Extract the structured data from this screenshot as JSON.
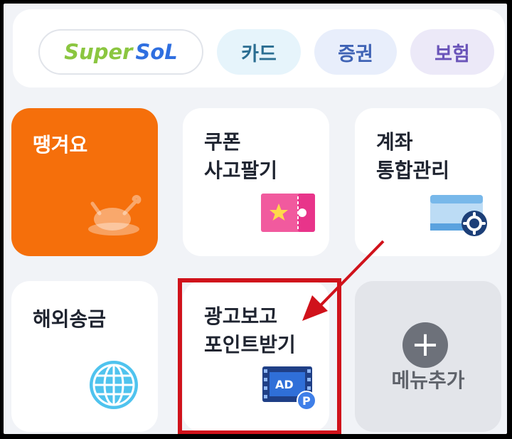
{
  "top_bar": {
    "supersol": {
      "part1": "Super",
      "part2": "SoL"
    },
    "card_label": "카드",
    "securities_label": "증권",
    "insurance_label": "보험"
  },
  "tiles": {
    "ttanggyeoyo": {
      "label": "땡겨요",
      "icon": "roast-chicken-icon"
    },
    "coupon": {
      "label": "쿠폰\n사고팔기",
      "icon": "ticket-star-icon"
    },
    "account": {
      "label": "계좌\n통합관리",
      "icon": "card-settings-icon"
    },
    "remittance": {
      "label": "해외송금",
      "icon": "globe-icon"
    },
    "ad_points": {
      "label": "광고보고\n포인트받기",
      "icon": "ad-film-icon",
      "badge_ad": "AD",
      "badge_p": "P"
    },
    "add_menu": {
      "label": "메뉴추가",
      "icon": "plus-icon"
    }
  },
  "annotation": {
    "highlight_color": "#d0121b"
  },
  "colors": {
    "orange_tile": "#f56f0b",
    "sol_green": "#8bc640",
    "sol_blue": "#2f6fe0"
  }
}
